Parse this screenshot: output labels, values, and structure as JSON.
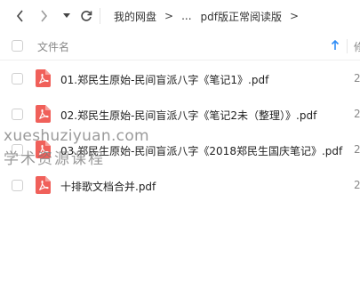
{
  "toolbar": {
    "back_icon": "chevron-left-icon",
    "forward_icon": "chevron-right-icon",
    "dropdown_icon": "caret-down-icon",
    "refresh_icon": "refresh-icon",
    "breadcrumb": [
      "我的网盘",
      "...",
      "pdf版正常阅读版"
    ],
    "separator": ">"
  },
  "table": {
    "column_name": "文件名",
    "column_more": "修",
    "sort_icon": "arrow-up-icon"
  },
  "files": [
    {
      "name": "01.郑民生原始-民间盲派八字《笔记1》.pdf",
      "trail": "2"
    },
    {
      "name": "02.郑民生原始-民间盲派八字《笔记2未（整理）》.pdf",
      "trail": "2"
    },
    {
      "name": "03.郑民生原始-民间盲派八字《2018郑民生国庆笔记》.pdf",
      "trail": "2"
    },
    {
      "name": "十排歌文档合并.pdf",
      "trail": "2"
    }
  ],
  "watermark": {
    "line1": "xueshuziyuan.com",
    "line2": "学术资源课程"
  },
  "colors": {
    "pdf_icon": "#f0605a",
    "accent": "#2f8df6"
  }
}
